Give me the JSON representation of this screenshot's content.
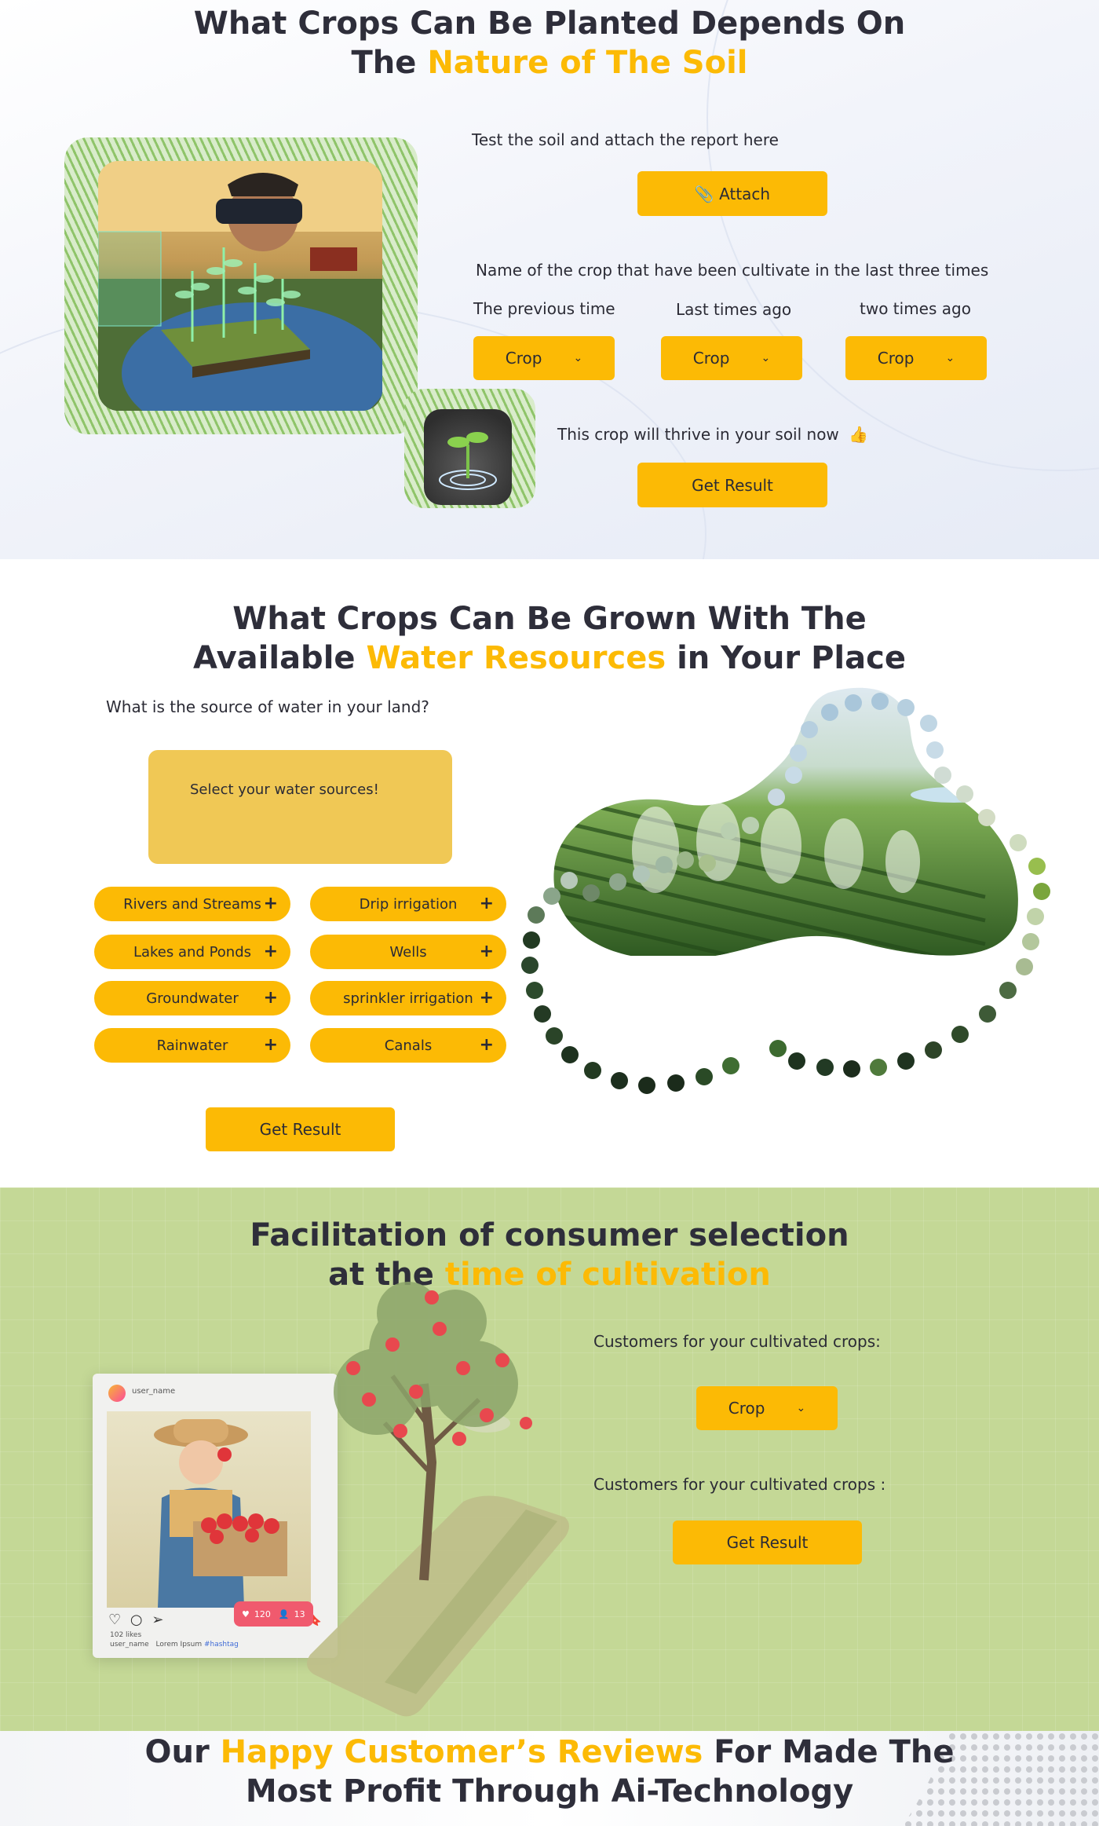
{
  "soil_section": {
    "title_line1": "What Crops Can Be Planted Depends On",
    "title_line2_prefix": "The ",
    "title_line2_highlight": "Nature of The Soil",
    "test_instruction": "Test the soil and attach the report here",
    "attach_label": "📎 Attach",
    "crop_history_label": "Name of the crop that have been cultivate  in the last three times",
    "col1_label": "The previous time",
    "col2_label": "Last times ago",
    "col3_label": "two times ago",
    "select1": "Crop",
    "select2": "Crop",
    "select3": "Crop",
    "thrive_text": "This crop will thrive in your soil now",
    "get_result": "Get Result"
  },
  "water_section": {
    "title_line1": "What Crops Can Be Grown With The",
    "title_line2_prefix": "Available ",
    "title_line2_highlight": "Water Resources",
    "title_line2_suffix": " in Your Place",
    "question": "What is the source of water in your land?",
    "select_box_text": "Select your water sources!",
    "options": [
      "Rivers and Streams",
      "Drip irrigation",
      "Lakes and Ponds",
      "Wells",
      "Groundwater",
      "sprinkler irrigation",
      "Rainwater",
      "Canals"
    ],
    "plus": "+",
    "get_result": "Get Result"
  },
  "consumer_section": {
    "title_line1": "Facilitation of consumer selection",
    "title_line2_prefix": "at the ",
    "title_line2_highlight": "time of cultivation",
    "customers_label1": "Customers for your cultivated crops:",
    "select_crop": "Crop",
    "customers_label2": "Customers for your cultivated crops :",
    "get_result": "Get Result",
    "social_card": {
      "user_name": "user_name",
      "likes": "102 likes",
      "caption_user": "user_name",
      "caption_text": "Lorem Ipsum",
      "hashtag": "#hashtag",
      "like_count": "120",
      "follower_count": "13"
    }
  },
  "reviews_section": {
    "title_prefix": "Our ",
    "title_highlight": "Happy Customer’s Reviews",
    "title_suffix": " For Made The",
    "title_line2": "Most Profit Through Ai-Technology"
  },
  "colors": {
    "accent": "#fcba05",
    "select_box": "#f0c855",
    "green_bg": "#c4d896",
    "text": "#2e2e3a"
  }
}
